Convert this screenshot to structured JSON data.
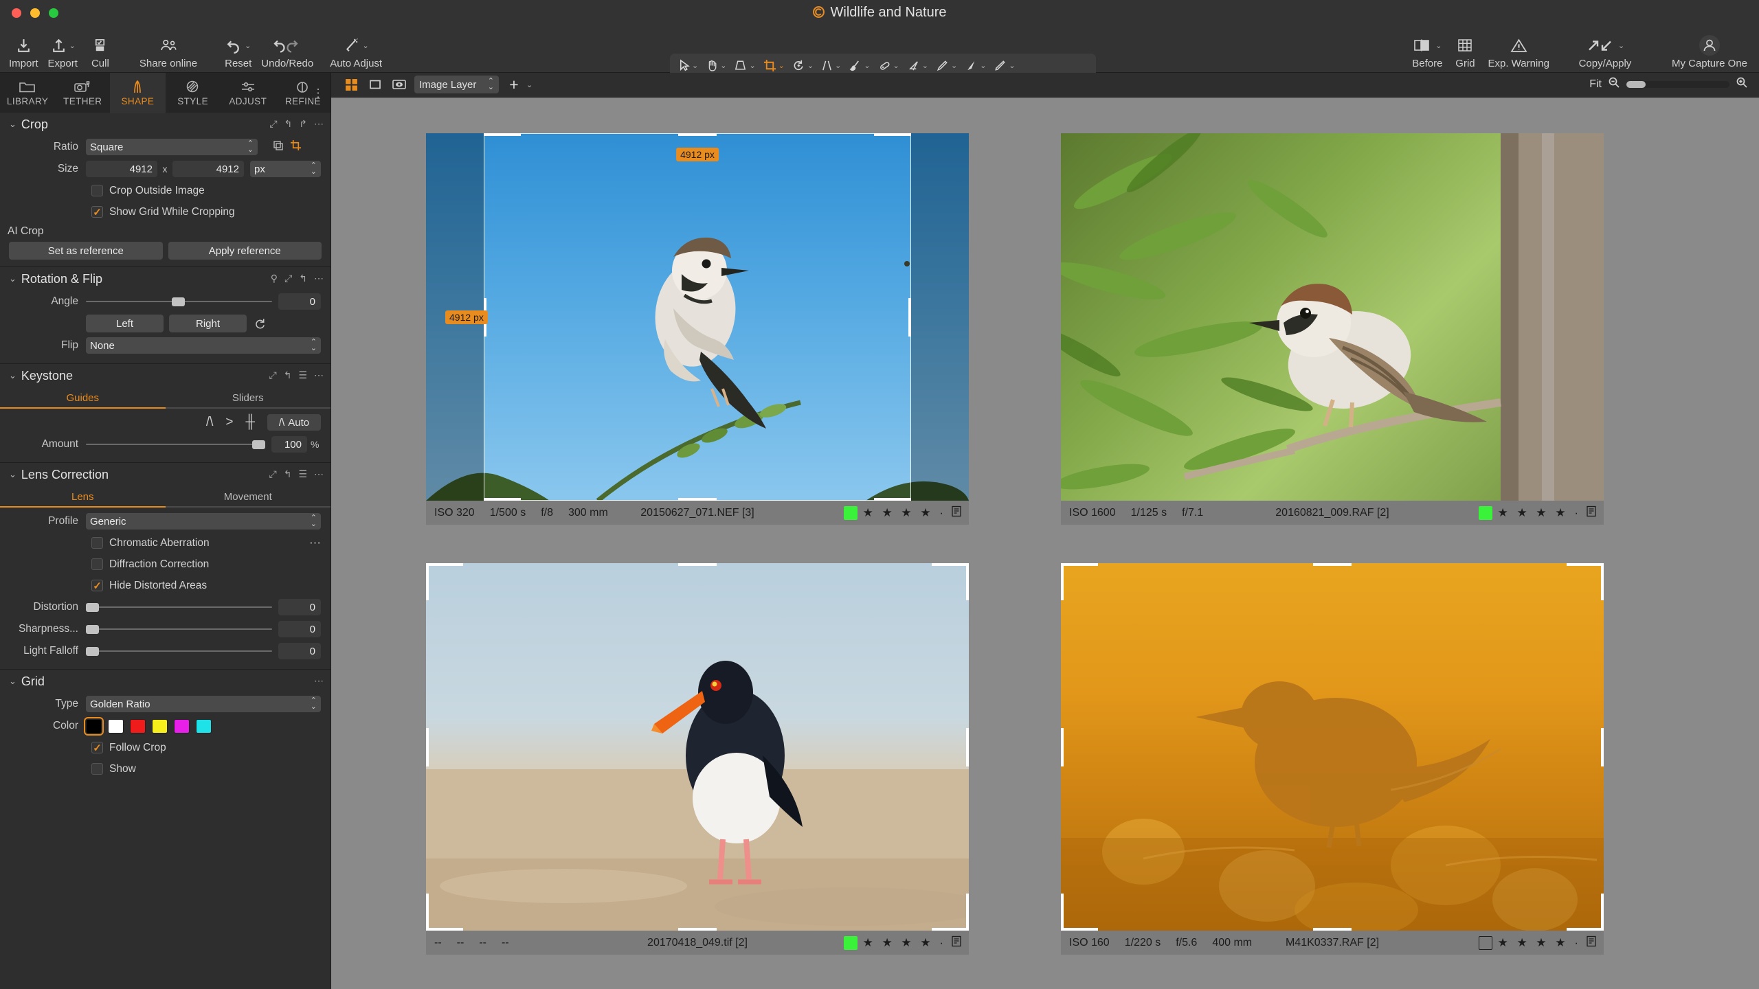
{
  "window": {
    "title": "Wildlife and Nature",
    "app_icon": "capture-one-icon"
  },
  "toolbar": {
    "left_items": [
      {
        "label": "Import",
        "icon": "import-icon",
        "caret": false
      },
      {
        "label": "Export",
        "icon": "export-icon",
        "caret": true
      },
      {
        "label": "Cull",
        "icon": "cull-icon",
        "caret": false
      },
      {
        "label": "Share online",
        "icon": "share-online-icon",
        "caret": false
      },
      {
        "label": "Reset",
        "icon": "reset-icon",
        "caret": true
      },
      {
        "label": "Undo/Redo",
        "icon": "undo-redo-icon",
        "caret": false
      },
      {
        "label": "Auto Adjust",
        "icon": "auto-adjust-icon",
        "caret": true
      }
    ],
    "cursor_tools": {
      "caption": "Cursor Tools",
      "active_index": 3,
      "tools": [
        "select-arrow-icon",
        "pan-hand-icon",
        "keystone-icon",
        "crop-icon",
        "rotate-icon",
        "straighten-icon",
        "brush-icon",
        "heal-icon",
        "eraser-icon",
        "draw-pen-icon",
        "gradient-icon",
        "color-picker-icon"
      ]
    },
    "right_items": [
      {
        "label": "Before",
        "icon": "before-after-icon",
        "caret": true
      },
      {
        "label": "Grid",
        "icon": "grid-icon",
        "caret": false
      },
      {
        "label": "Exp. Warning",
        "icon": "exposure-warning-icon",
        "caret": false
      },
      {
        "label": "Copy/Apply",
        "icon": "copy-apply-icon",
        "caret": true
      },
      {
        "label": "My Capture One",
        "icon": "user-avatar-icon",
        "caret": false
      }
    ]
  },
  "subbar": {
    "layer_select_value": "Image Layer",
    "add_layer_label": "+",
    "zoom_label": "Fit"
  },
  "tool_tabs": [
    {
      "label": "LIBRARY",
      "icon": "folder-icon",
      "active": false
    },
    {
      "label": "TETHER",
      "icon": "camera-icon",
      "active": false
    },
    {
      "label": "SHAPE",
      "icon": "shape-icon",
      "active": true
    },
    {
      "label": "STYLE",
      "icon": "style-icon",
      "active": false
    },
    {
      "label": "ADJUST",
      "icon": "adjust-sliders-icon",
      "active": false
    },
    {
      "label": "REFINE",
      "icon": "refine-icon",
      "active": false
    }
  ],
  "crop": {
    "title": "Crop",
    "ratio_label": "Ratio",
    "ratio_value": "Square",
    "size_label": "Size",
    "size_width": "4912",
    "size_x": "x",
    "size_height": "4912",
    "size_unit": "px",
    "crop_outside_label": "Crop Outside Image",
    "crop_outside_checked": false,
    "show_grid_label": "Show Grid While Cropping",
    "show_grid_checked": true,
    "ai_crop_label": "AI Crop",
    "set_reference_label": "Set as reference",
    "apply_reference_label": "Apply reference"
  },
  "rotation": {
    "title": "Rotation & Flip",
    "angle_label": "Angle",
    "angle_value": "0",
    "left_label": "Left",
    "right_label": "Right",
    "flip_label": "Flip",
    "flip_value": "None"
  },
  "keystone": {
    "title": "Keystone",
    "tabs": [
      {
        "label": "Guides",
        "active": true
      },
      {
        "label": "Sliders",
        "active": false
      }
    ],
    "guide_buttons": [
      "vertical-keystone-icon",
      "horizontal-keystone-icon",
      "full-keystone-icon"
    ],
    "auto_label": "Auto",
    "amount_label": "Amount",
    "amount_value": "100",
    "amount_unit": "%"
  },
  "lens": {
    "title": "Lens Correction",
    "tabs": [
      {
        "label": "Lens",
        "active": true
      },
      {
        "label": "Movement",
        "active": false
      }
    ],
    "profile_label": "Profile",
    "profile_value": "Generic",
    "chromatic_label": "Chromatic Aberration",
    "chromatic_checked": false,
    "diffraction_label": "Diffraction Correction",
    "diffraction_checked": false,
    "hide_distorted_label": "Hide Distorted Areas",
    "hide_distorted_checked": true,
    "sliders": [
      {
        "label": "Distortion",
        "value": "0"
      },
      {
        "label": "Sharpness...",
        "value": "0"
      },
      {
        "label": "Light Falloff",
        "value": "0"
      }
    ]
  },
  "grid": {
    "title": "Grid",
    "type_label": "Type",
    "type_value": "Golden Ratio",
    "color_label": "Color",
    "colors": [
      "#000000",
      "#ffffff",
      "#f01c1c",
      "#f6ef1b",
      "#e81fe8",
      "#1fe2e8"
    ],
    "selected_color_index": 0,
    "follow_crop_label": "Follow Crop",
    "follow_crop_checked": true,
    "show_label": "Show",
    "show_checked": false
  },
  "crop_overlay": {
    "width_badge": "4912 px",
    "height_badge": "4912 px"
  },
  "thumbnails": [
    {
      "iso": "ISO 320",
      "shutter": "1/500 s",
      "aperture": "f/8",
      "focal": "300 mm",
      "filename": "20150627_071.NEF [3]",
      "color_tag": "#3bf23b",
      "stars": "★ ★ ★ ★ ·",
      "selected": true,
      "subject": "sparrow-on-branch-blue-sky"
    },
    {
      "iso": "ISO 1600",
      "shutter": "1/125 s",
      "aperture": "f/7.1",
      "focal": "",
      "filename": "20160821_009.RAF [2]",
      "color_tag": "#3bf23b",
      "stars": "★ ★ ★ ★ ·",
      "selected": true,
      "subject": "sparrow-in-green-foliage"
    },
    {
      "iso": "--",
      "shutter": "--",
      "aperture": "--",
      "focal": "--",
      "filename": "20170418_049.tif [2]",
      "color_tag": "#3bf23b",
      "stars": "★ ★ ★ ★ ·",
      "selected": true,
      "subject": "oystercatcher-on-beach"
    },
    {
      "iso": "ISO 160",
      "shutter": "1/220 s",
      "aperture": "f/5.6",
      "focal": "400 mm",
      "filename": "M41K0337.RAF [2]",
      "color_tag": "none",
      "stars": "★ ★ ★ ★ ·",
      "selected": true,
      "subject": "bird-silhouette-golden-sunset"
    }
  ],
  "accent_color": "#e98c1f"
}
